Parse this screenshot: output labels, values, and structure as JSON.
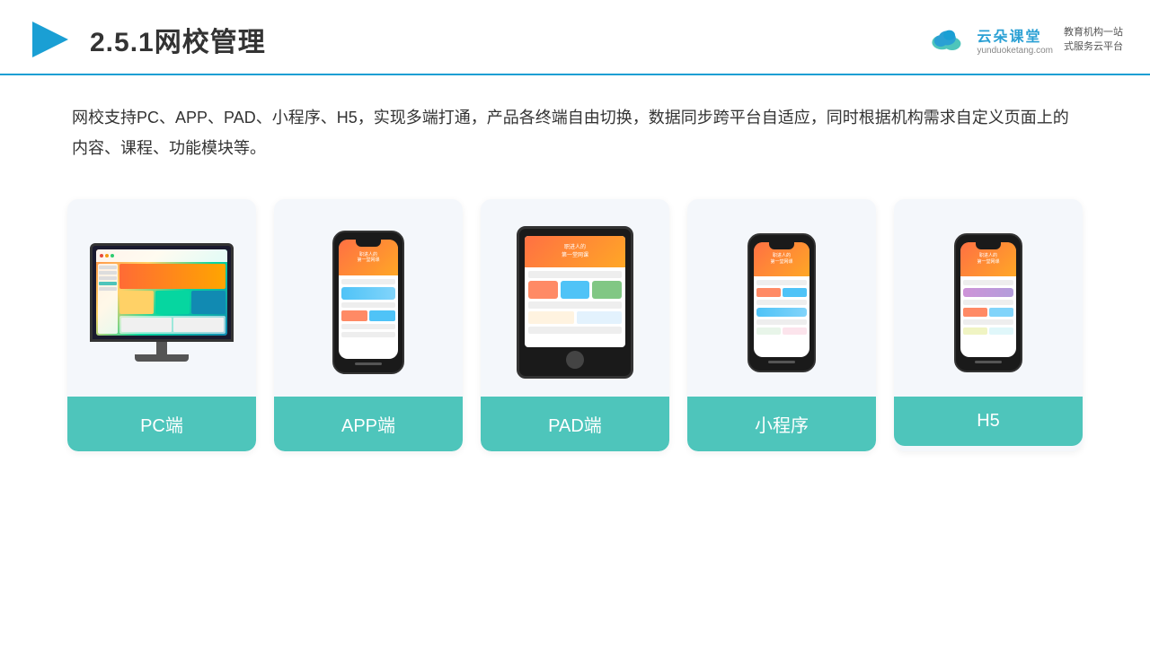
{
  "header": {
    "title": "2.5.1网校管理",
    "brand_name": "云朵课堂",
    "brand_url": "yunduoketang.com",
    "brand_slogan": "教育机构一站\n式服务云平台"
  },
  "description": {
    "text": "网校支持PC、APP、PAD、小程序、H5，实现多端打通，产品各终端自由切换，数据同步跨平台自适应，同时根据机构需求自定义页面上的内容、课程、功能模块等。"
  },
  "cards": [
    {
      "id": "pc",
      "label": "PC端"
    },
    {
      "id": "app",
      "label": "APP端"
    },
    {
      "id": "pad",
      "label": "PAD端"
    },
    {
      "id": "miniprogram",
      "label": "小程序"
    },
    {
      "id": "h5",
      "label": "H5"
    }
  ],
  "colors": {
    "accent": "#4ec5bb",
    "header_line": "#1a9fd4",
    "title_color": "#333333"
  }
}
